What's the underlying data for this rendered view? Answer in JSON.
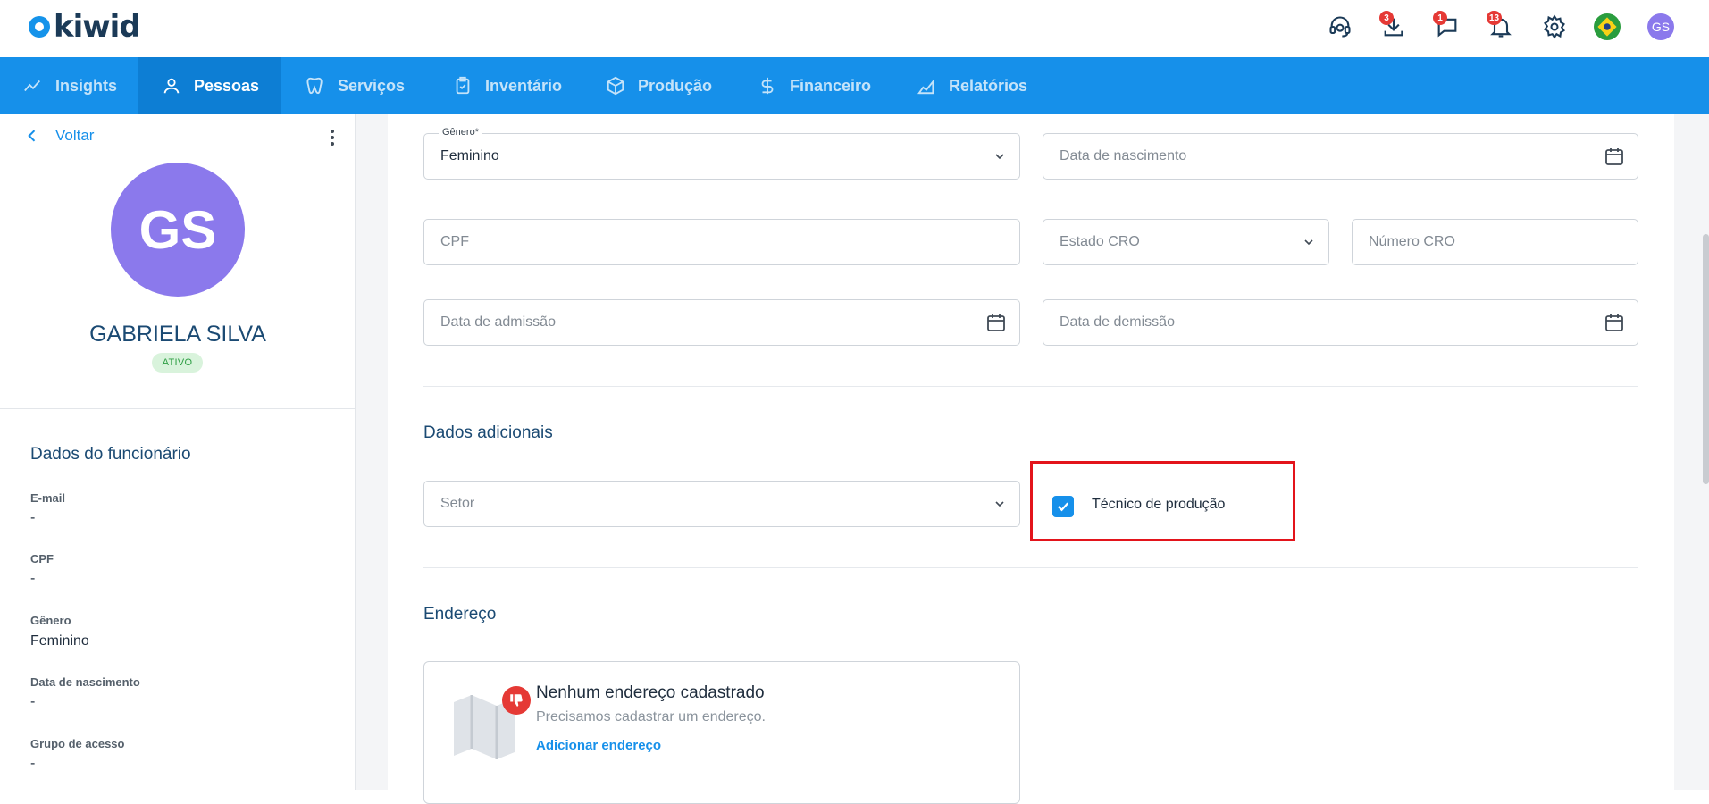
{
  "brand": {
    "logo_text": "kiwid",
    "accent": "#1690ea"
  },
  "topbar": {
    "downloads_badge": "3",
    "messages_badge": "1",
    "notifications_badge": "13",
    "user_initials": "GS"
  },
  "nav": {
    "items": [
      {
        "label": "Insights",
        "icon": "trend-line-icon"
      },
      {
        "label": "Pessoas",
        "icon": "person-icon",
        "active": true
      },
      {
        "label": "Serviços",
        "icon": "tooth-icon"
      },
      {
        "label": "Inventário",
        "icon": "clipboard-check-icon"
      },
      {
        "label": "Produção",
        "icon": "box-icon"
      },
      {
        "label": "Financeiro",
        "icon": "dollar-icon"
      },
      {
        "label": "Relatórios",
        "icon": "area-chart-icon"
      }
    ]
  },
  "sidebar": {
    "back_label": "Voltar",
    "avatar_initials": "GS",
    "name": "GABRIELA SILVA",
    "status": "ATIVO",
    "section_title": "Dados do funcionário",
    "fields": [
      {
        "label": "E-mail",
        "value": "-"
      },
      {
        "label": "CPF",
        "value": "-"
      },
      {
        "label": "Gênero",
        "value": "Feminino"
      },
      {
        "label": "Data de nascimento",
        "value": "-"
      },
      {
        "label": "Grupo de acesso",
        "value": "-"
      }
    ]
  },
  "form": {
    "genero": {
      "label": "Gênero*",
      "value": "Feminino"
    },
    "data_nascimento": {
      "placeholder": "Data de nascimento"
    },
    "cpf": {
      "placeholder": "CPF"
    },
    "estado_cro": {
      "placeholder": "Estado CRO"
    },
    "numero_cro": {
      "placeholder": "Número CRO"
    },
    "data_admissao": {
      "placeholder": "Data de admissão"
    },
    "data_demissao": {
      "placeholder": "Data de demissão"
    },
    "dados_adicionais_title": "Dados adicionais",
    "setor": {
      "placeholder": "Setor"
    },
    "tecnico_producao": {
      "label": "Técnico de produção",
      "checked": true
    },
    "endereco_title": "Endereço",
    "address_empty": {
      "title": "Nenhum endereço cadastrado",
      "subtitle": "Precisamos cadastrar um endereço.",
      "link": "Adicionar endereço"
    }
  }
}
